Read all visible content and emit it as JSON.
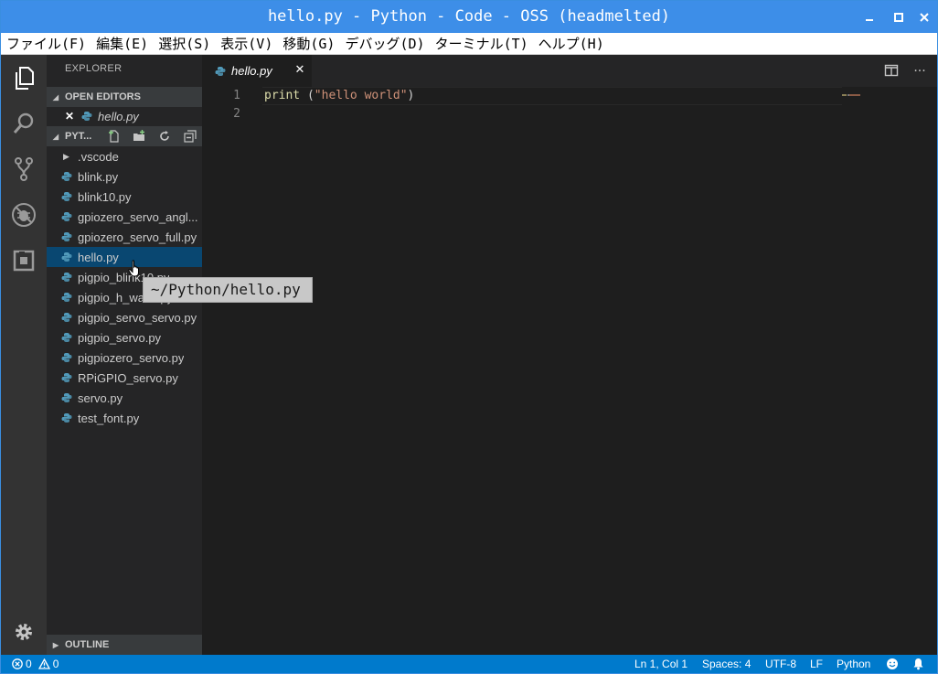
{
  "window": {
    "title": "hello.py - Python - Code - OSS (headmelted)"
  },
  "menu": [
    "ファイル(F)",
    "編集(E)",
    "選択(S)",
    "表示(V)",
    "移動(G)",
    "デバッグ(D)",
    "ターミナル(T)",
    "ヘルプ(H)"
  ],
  "sidebar": {
    "title": "EXPLORER",
    "open_editors_header": "OPEN EDITORS",
    "open_editor_file": "hello.py",
    "folder_header": "PYT...",
    "outline_header": "OUTLINE",
    "folder_item": ".vscode",
    "files": [
      "blink.py",
      "blink10.py",
      "gpiozero_servo_angl...",
      "gpiozero_servo_full.py",
      "hello.py",
      "pigpio_blink10.py",
      "pigpio_h_wave.py",
      "pigpio_servo_servo.py",
      "pigpio_servo.py",
      "pigpiozero_servo.py",
      "RPiGPIO_servo.py",
      "servo.py",
      "test_font.py"
    ],
    "selected_index": 4
  },
  "editor": {
    "tab_label": "hello.py",
    "line_numbers": [
      "1",
      "2"
    ],
    "code": {
      "fn": "print",
      "open": " (",
      "str": "\"hello world\"",
      "close": ")"
    }
  },
  "tooltip": "~/Python/hello.py",
  "statusbar": {
    "errors": "0",
    "warnings": "0",
    "position": "Ln 1, Col 1",
    "spaces": "Spaces: 4",
    "encoding": "UTF-8",
    "eol": "LF",
    "language": "Python"
  },
  "colors": {
    "titlebar": "#3d8ee8",
    "statusbar": "#007acc",
    "selection": "#094771",
    "python_icon": "#519aba"
  },
  "icons": {
    "activity": [
      "files-icon",
      "search-icon",
      "source-control-icon",
      "debug-icon",
      "extensions-icon",
      "settings-gear-icon"
    ]
  }
}
